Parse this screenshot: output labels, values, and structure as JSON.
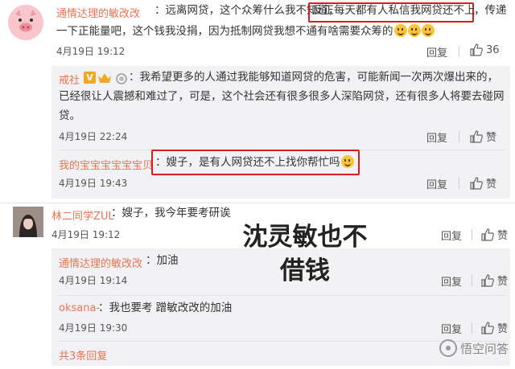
{
  "comments": [
    {
      "user": "通情达理的敏改改",
      "text_a": "：远离网贷，这个众筹什么我不知道，",
      "text_boxed": "反正每天都有人私信我网贷还不上",
      "text_b": "，传递",
      "text_c": "一下正能量吧，这个钱我没捐，因为抵制网贷我想不通有啥需要众筹的",
      "time": "4月19日 19:12",
      "reply": "回复",
      "likes": "36"
    },
    {
      "user": "林二同学ZUL",
      "text": "：嫂子，我今年要考研诶",
      "time": "4月19日 19:12",
      "reply": "回复",
      "likes": "赞"
    }
  ],
  "subcomments_1": [
    {
      "user": "戒社",
      "text_line1": "：我希望更多的人通过我能够知道网贷的危害，可能新闻一次两次爆出来的，",
      "text_line2": "已经很让人震撼和难过了，可是，这个社会还有很多很多人深陷网贷，还有很多人将要去碰网",
      "text_line3": "贷。",
      "time": "4月19日 22:24",
      "reply": "回复",
      "likes": "赞"
    },
    {
      "user": "我的宝宝宝宝宝宝贝",
      "text": "：嫂子，是有人网贷还不上找你帮忙吗",
      "time": "4月19日 19:43",
      "reply": "回复",
      "likes": "赞"
    }
  ],
  "subcomments_2": [
    {
      "user": "通情达理的敏改改",
      "text": "：加油",
      "time": "4月19日 19:14",
      "reply": "回复",
      "likes": "赞"
    },
    {
      "user": "oksana-",
      "text": "：我也要考 蹭敏改改的加油",
      "time": "4月19日 19:30",
      "reply": "回复",
      "likes": "赞"
    }
  ],
  "more_replies": "共3条回复",
  "overlay_text_line1": "沈灵敏也不",
  "overlay_text_line2": "借钱",
  "watermark": "悟空问答",
  "icons": [
    "pig-avatar-icon",
    "girl-avatar-icon",
    "thumbs-up-icon",
    "v-badge-icon",
    "vip-crown-icon",
    "emoji-icon",
    "wukong-logo-icon"
  ],
  "colors": {
    "username": "#eb7350",
    "highlight_box": "#d81e1e",
    "sub_bg": "#f2f2f5"
  }
}
